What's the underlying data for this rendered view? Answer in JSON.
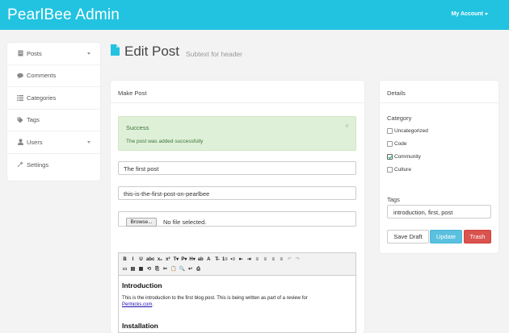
{
  "header": {
    "brand": "PearlBee Admin",
    "account_label": "My Account"
  },
  "sidebar": {
    "items": [
      {
        "label": "Posts",
        "icon": "document-icon",
        "has_caret": true
      },
      {
        "label": "Comments",
        "icon": "comment-icon",
        "has_caret": false
      },
      {
        "label": "Categories",
        "icon": "list-icon",
        "has_caret": false
      },
      {
        "label": "Tags",
        "icon": "tag-icon",
        "has_caret": false
      },
      {
        "label": "Users",
        "icon": "user-icon",
        "has_caret": true
      },
      {
        "label": "Settings",
        "icon": "wrench-icon",
        "has_caret": false
      }
    ]
  },
  "page": {
    "title": "Edit Post",
    "subtitle": "Subtext for header",
    "icon": "file-icon"
  },
  "make_post": {
    "panel_title": "Make Post",
    "alert": {
      "title": "Success",
      "message": "The post was added successfully",
      "close": "×"
    },
    "title_value": "The first post",
    "slug_value": "this-is-the-first-post-on-pearlbee",
    "file": {
      "button_label": "Browse...",
      "status": "No file selected."
    },
    "editor": {
      "toolbar_row1": [
        "B",
        "I",
        "U",
        "abc",
        "x₂",
        "x²",
        "T▾",
        "P▾",
        "H▾",
        "ab",
        "A",
        "T̶",
        "1≡",
        "•≡",
        "⇤",
        "⇥",
        "≡",
        "≡",
        "≡",
        "≡",
        "↶",
        "↷"
      ],
      "toolbar_row2": [
        "▭",
        "▤",
        "▦",
        "⟲",
        "⎘",
        "✂",
        "📋",
        "🔍",
        "↩",
        "⎙"
      ],
      "heading1": "Introduction",
      "paragraph_before_link": "This is the introduction to the first blog post. This is being written as part of a review for ",
      "link_text": "Perlnicks.com",
      "paragraph_after_link": ".",
      "heading2": "Installation"
    }
  },
  "details": {
    "panel_title": "Details",
    "category_label": "Category",
    "categories": [
      {
        "label": "Uncategorized",
        "checked": false
      },
      {
        "label": "Code",
        "checked": false
      },
      {
        "label": "Community",
        "checked": true
      },
      {
        "label": "Culture",
        "checked": false
      }
    ],
    "tags_label": "Tags",
    "tags_value": "introduction, first, post",
    "buttons": {
      "save_draft": "Save Draft",
      "update": "Update",
      "trash": "Trash"
    }
  }
}
